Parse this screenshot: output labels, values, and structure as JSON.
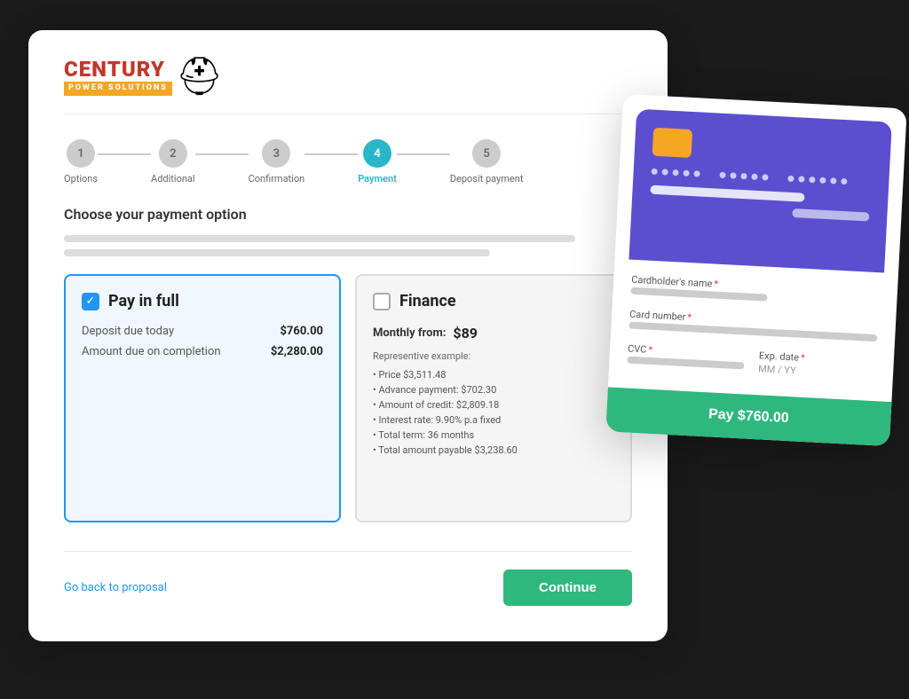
{
  "brand": {
    "name_part1": "CENTURY",
    "name_part2": "POWER SOLUTIONS",
    "helmet_emoji": "🪖"
  },
  "steps": [
    {
      "number": "1",
      "label": "Options",
      "active": false
    },
    {
      "number": "2",
      "label": "Additional",
      "active": false
    },
    {
      "number": "3",
      "label": "Confirmation",
      "active": false
    },
    {
      "number": "4",
      "label": "Payment",
      "active": true
    },
    {
      "number": "5",
      "label": "Deposit payment",
      "active": false
    }
  ],
  "section_title": "Choose your payment option",
  "pay_in_full": {
    "title": "Pay in full",
    "checked": true,
    "deposit_label": "Deposit due today",
    "deposit_amount": "$760.00",
    "completion_label": "Amount due on completion",
    "completion_amount": "$2,280.00"
  },
  "finance": {
    "title": "Finance",
    "checked": false,
    "monthly_label": "Monthly from:",
    "monthly_amount": "$89",
    "example_label": "Representive example:",
    "items": [
      "Price $3,511.48",
      "Advance payment: $702.30",
      "Amount of credit: $2,809.18",
      "Interest rate: 9.90% p.a fixed",
      "Total term: 36 months",
      "Total amount payable $3,238.60"
    ]
  },
  "bottom": {
    "back_link": "Go back to proposal",
    "continue_button": "Continue"
  },
  "card_overlay": {
    "cardholder_label": "Cardholder's name",
    "card_number_label": "Card number",
    "cvc_label": "CVC",
    "exp_date_label": "Exp. date",
    "exp_date_placeholder": "MM / YY",
    "pay_button": "Pay $760.00"
  }
}
